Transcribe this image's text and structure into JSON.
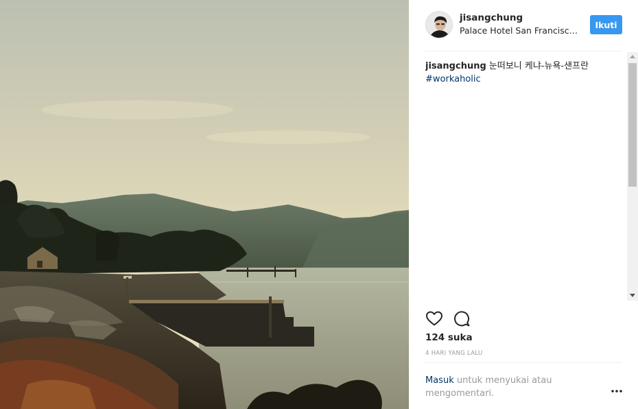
{
  "post": {
    "author": {
      "username": "jisangchung",
      "location": "Palace Hotel San Francisc…"
    },
    "follow_label": "Ikuti",
    "caption": {
      "username": "jisangchung",
      "text": " 눈떠보니 케냐-뉴욕-샌프란",
      "hashtag": "#workaholic"
    },
    "likes": "124 suka",
    "timestamp": "4 HARI YANG LALU",
    "login_prompt": {
      "link": "Masuk",
      "text": " untuk menyukai atau mengomentari."
    }
  },
  "icons": {
    "like": "heart-icon",
    "comment": "comment-bubble-icon",
    "more": "more-options-icon",
    "scroll_up": "scroll-up-arrow-icon",
    "scroll_down": "scroll-down-arrow-icon"
  },
  "colors": {
    "follow_button": "#3897f0",
    "link": "#003569",
    "muted_text": "#999999",
    "text": "#262626",
    "divider": "#efefef"
  }
}
